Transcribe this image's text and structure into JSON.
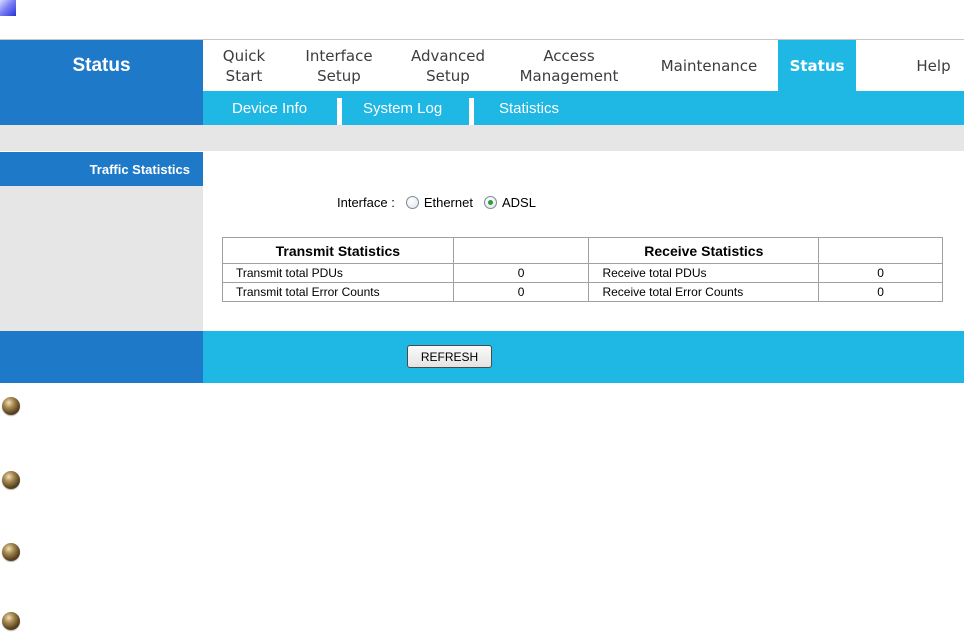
{
  "header": {
    "title": "Status"
  },
  "nav": {
    "quick_start": [
      "Quick",
      "Start"
    ],
    "interface_setup": [
      "Interface",
      "Setup"
    ],
    "advanced_setup": [
      "Advanced",
      "Setup"
    ],
    "access_management": [
      "Access",
      "Management"
    ],
    "maintenance": "Maintenance",
    "status": "Status",
    "help": "Help",
    "active": "Status"
  },
  "subnav": {
    "items": [
      "Device Info",
      "System Log",
      "Statistics"
    ]
  },
  "section": {
    "label": "Traffic Statistics"
  },
  "interface": {
    "label": "Interface :",
    "options": [
      "Ethernet",
      "ADSL"
    ],
    "selected": "ADSL"
  },
  "table": {
    "headers": [
      "Transmit Statistics",
      "",
      "Receive Statistics",
      ""
    ],
    "rows": [
      [
        "Transmit total PDUs",
        "0",
        "Receive total PDUs",
        "0"
      ],
      [
        "Transmit total Error Counts",
        "0",
        "Receive total Error Counts",
        "0"
      ]
    ]
  },
  "actions": {
    "refresh_label": "REFRESH"
  },
  "colors": {
    "brand_blue": "#1f79c9",
    "accent_cyan": "#1fb7e4",
    "panel_grey": "#e6e6e6"
  },
  "icons": {
    "bullet": "bronze-bullet-icon",
    "corner": "blue-gradient-square-icon"
  }
}
